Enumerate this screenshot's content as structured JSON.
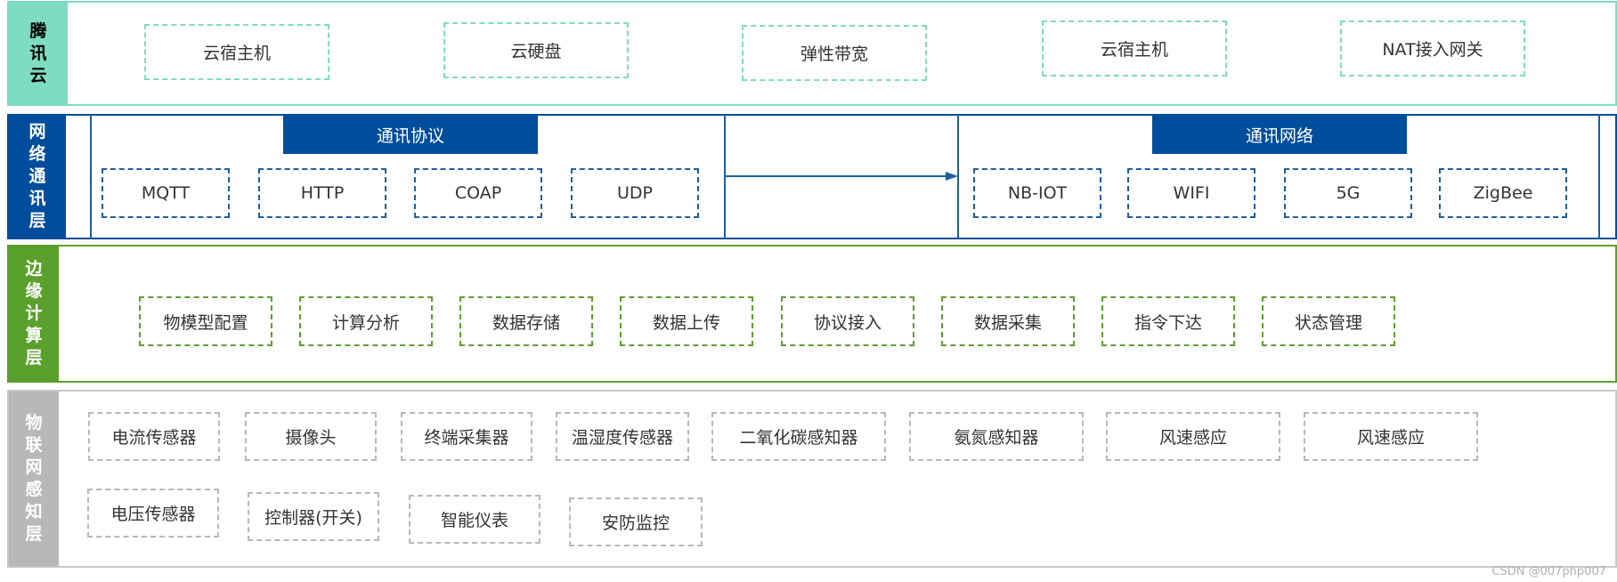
{
  "layers": {
    "cloud": {
      "label": [
        "腾",
        "讯",
        "云"
      ],
      "items": [
        "云宿主机",
        "云硬盘",
        "弹性带宽",
        "云宿主机",
        "NAT接入网关"
      ]
    },
    "network": {
      "label": [
        "网",
        "络",
        "通",
        "讯",
        "层"
      ],
      "protocol_title": "通讯协议",
      "protocols": [
        "MQTT",
        "HTTP",
        "COAP",
        "UDP"
      ],
      "network_title": "通讯网络",
      "networks": [
        "NB-IOT",
        "WIFI",
        "5G",
        "ZigBee"
      ]
    },
    "edge": {
      "label": [
        "边",
        "缘",
        "计",
        "算",
        "层"
      ],
      "items": [
        "物模型配置",
        "计算分析",
        "数据存储",
        "数据上传",
        "协议接入",
        "数据采集",
        "指令下达",
        "状态管理"
      ]
    },
    "iot": {
      "label": [
        "物",
        "联",
        "网",
        "感",
        "知",
        "层"
      ],
      "row1": [
        "电流传感器",
        "摄像头",
        "终端采集器",
        "温湿度传感器",
        "二氧化碳感知器",
        "氨氮感知器",
        "风速感应",
        "风速感应"
      ],
      "row2": [
        "电压传感器",
        "控制器(开关)",
        "智能仪表",
        "安防监控"
      ]
    }
  },
  "watermark": "CSDN @007php007",
  "colors": {
    "cloud": "#7edcc0",
    "network": "#004d9c",
    "edge": "#5aa02c",
    "iot": "#b8b8b8"
  }
}
